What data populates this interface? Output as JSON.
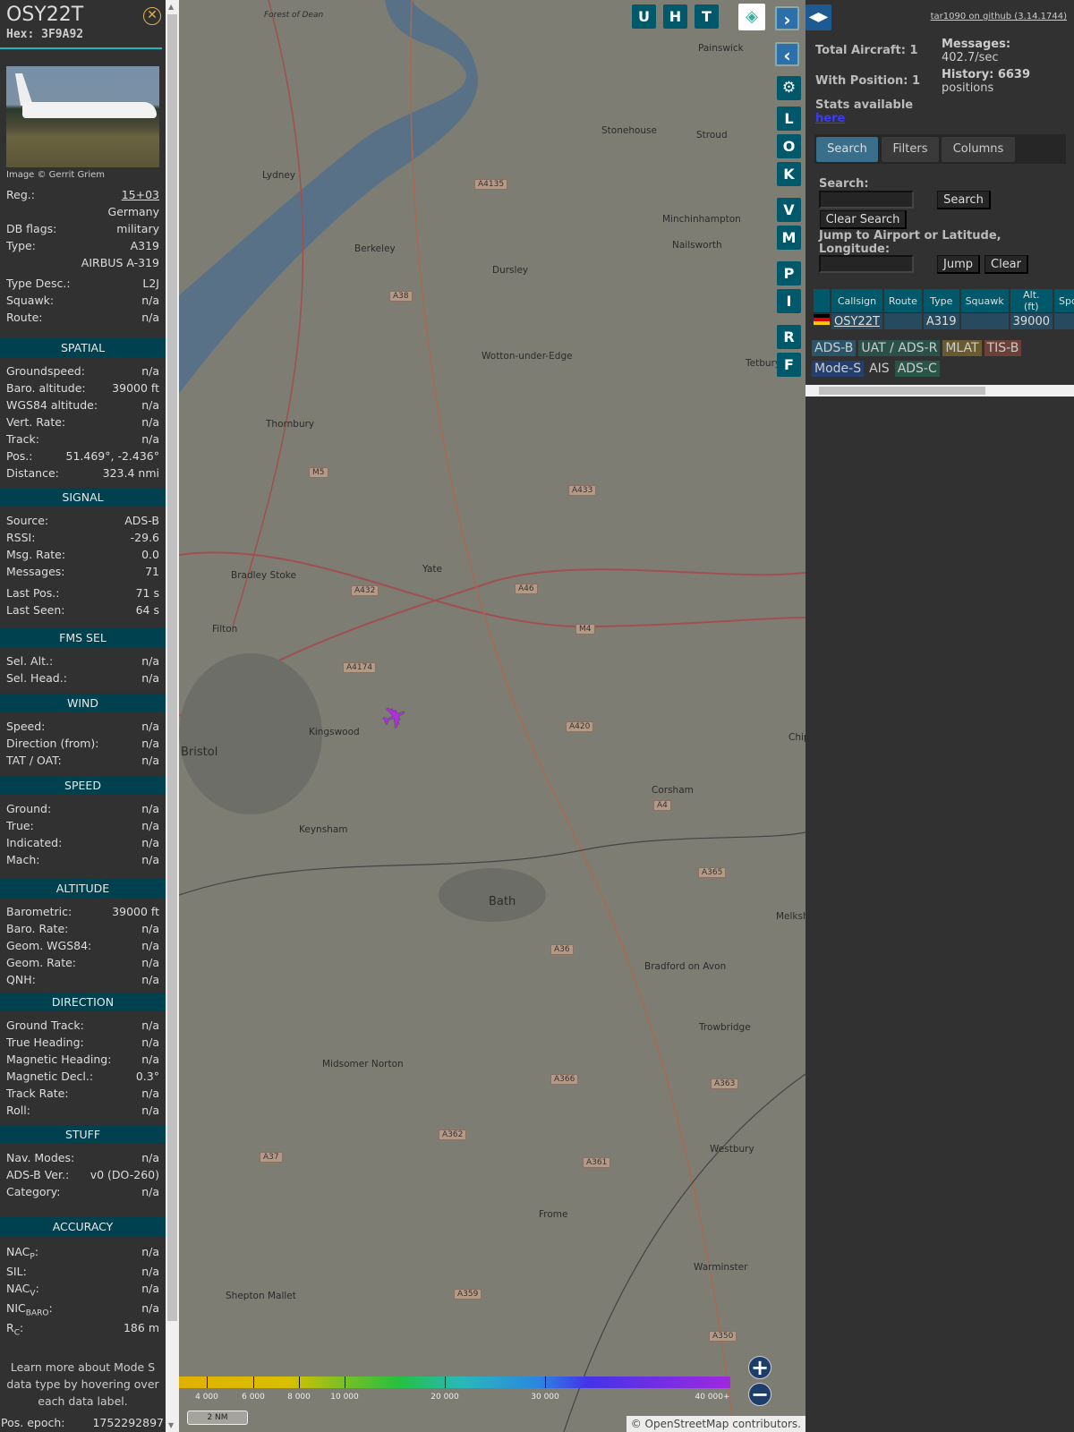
{
  "aircraft": {
    "callsign": "OSY22T",
    "hex_label": "Hex:",
    "hex": "3F9A92",
    "image_credit": "Image © Gerrit Griem",
    "info_rows": [
      {
        "label": "Reg.:",
        "value": "15+03"
      },
      {
        "label": "",
        "value": "Germany"
      },
      {
        "label": "DB flags:",
        "value": "military"
      },
      {
        "label": "Type:",
        "value": "A319"
      },
      {
        "label": "",
        "value": "AIRBUS A-319"
      },
      {
        "label": "Type Desc.:",
        "value": "L2J"
      },
      {
        "label": "Squawk:",
        "value": "n/a"
      },
      {
        "label": "Route:",
        "value": "n/a"
      }
    ],
    "sections": [
      {
        "title": "SPATIAL",
        "rows": [
          {
            "label": "Groundspeed:",
            "value": "n/a"
          },
          {
            "label": "Baro. altitude:",
            "value": "39000 ft"
          },
          {
            "label": "WGS84 altitude:",
            "value": "n/a"
          },
          {
            "label": "Vert. Rate:",
            "value": "n/a"
          },
          {
            "label": "Track:",
            "value": "n/a"
          },
          {
            "label": "Pos.:",
            "value": "51.469°, -2.436°"
          },
          {
            "label": "Distance:",
            "value": "323.4 nmi"
          }
        ]
      },
      {
        "title": "SIGNAL",
        "rows": [
          {
            "label": "Source:",
            "value": "ADS-B"
          },
          {
            "label": "RSSI:",
            "value": "-29.6"
          },
          {
            "label": "Msg. Rate:",
            "value": "0.0"
          },
          {
            "label": "Messages:",
            "value": "71"
          },
          {
            "label": "Last Pos.:",
            "value": "71 s"
          },
          {
            "label": "Last Seen:",
            "value": "64 s"
          }
        ]
      },
      {
        "title": "FMS SEL",
        "rows": [
          {
            "label": "Sel. Alt.:",
            "value": "n/a"
          },
          {
            "label": "Sel. Head.:",
            "value": "n/a"
          }
        ]
      },
      {
        "title": "WIND",
        "rows": [
          {
            "label": "Speed:",
            "value": "n/a"
          },
          {
            "label": "Direction (from):",
            "value": "n/a"
          },
          {
            "label": "TAT / OAT:",
            "value": "n/a"
          }
        ]
      },
      {
        "title": "SPEED",
        "rows": [
          {
            "label": "Ground:",
            "value": "n/a"
          },
          {
            "label": "True:",
            "value": "n/a"
          },
          {
            "label": "Indicated:",
            "value": "n/a"
          },
          {
            "label": "Mach:",
            "value": "n/a"
          }
        ]
      },
      {
        "title": "ALTITUDE",
        "rows": [
          {
            "label": "Barometric:",
            "value": "39000 ft"
          },
          {
            "label": "Baro. Rate:",
            "value": "n/a"
          },
          {
            "label": "Geom. WGS84:",
            "value": "n/a"
          },
          {
            "label": "Geom. Rate:",
            "value": "n/a"
          },
          {
            "label": "QNH:",
            "value": "n/a"
          }
        ]
      },
      {
        "title": "DIRECTION",
        "rows": [
          {
            "label": "Ground Track:",
            "value": "n/a"
          },
          {
            "label": "True Heading:",
            "value": "n/a"
          },
          {
            "label": "Magnetic Heading:",
            "value": "n/a"
          },
          {
            "label": "Magnetic Decl.:",
            "value": "0.3°"
          },
          {
            "label": "Track Rate:",
            "value": "n/a"
          },
          {
            "label": "Roll:",
            "value": "n/a"
          }
        ]
      },
      {
        "title": "STUFF",
        "rows": [
          {
            "label": "Nav. Modes:",
            "value": "n/a"
          },
          {
            "label": "ADS-B Ver.:",
            "value": "v0 (DO-260)"
          },
          {
            "label": "Category:",
            "value": "n/a"
          }
        ]
      }
    ],
    "accuracy": {
      "title": "ACCURACY",
      "nacp": {
        "label": "NAC",
        "sub": "P",
        "value": "n/a"
      },
      "sil": {
        "label": "SIL:",
        "value": "n/a"
      },
      "nacv": {
        "label": "NAC",
        "sub": "V",
        "value": "n/a"
      },
      "nicbaro": {
        "label": "NIC",
        "sub": "BARO",
        "value": "n/a"
      },
      "rc": {
        "label": "R",
        "sub": "C",
        "value": "186 m"
      }
    },
    "help_text": "Learn more about Mode S data type by hovering over each data label.",
    "pos_epoch": {
      "label": "Pos. epoch:",
      "value": "1752292897"
    }
  },
  "map": {
    "top_buttons": [
      "U",
      "H",
      "T"
    ],
    "side_buttons": [
      "L",
      "O",
      "K",
      "V",
      "M",
      "P",
      "I",
      "R",
      "F"
    ],
    "towns": [
      "Forest of Dean",
      "Painswick",
      "Stonehouse",
      "Stroud",
      "Lydney",
      "Minchinhampton",
      "Nailsworth",
      "Berkeley",
      "Dursley",
      "Wotton-under-Edge",
      "Tetbury",
      "Thornbury",
      "Yate",
      "Bradley Stoke",
      "Filton",
      "Kingswood",
      "Bristol",
      "Keynsham",
      "Corsham",
      "Bath",
      "Melksham",
      "Bradford on Avon",
      "Trowbridge",
      "Midsomer Norton",
      "Westbury",
      "Frome",
      "Warminster",
      "Shepton Mallet",
      "Chippenham"
    ],
    "roads": [
      "A4135",
      "A38",
      "M5",
      "A433",
      "A432",
      "A46",
      "M4",
      "A4174",
      "A420",
      "A4",
      "A365",
      "A36",
      "A366",
      "A363",
      "A362",
      "A37",
      "A361",
      "A359",
      "A350"
    ],
    "altitude_legend": [
      "4 000",
      "6 000",
      "8 000",
      "10 000",
      "20 000",
      "30 000",
      "40 000+"
    ],
    "scale": "2 NM",
    "attribution_prefix": "©",
    "attribution_link": "OpenStreetMap",
    "attribution_suffix": "contributors."
  },
  "stats": {
    "github": "tar1090 on github (3.14.1744)",
    "total_aircraft": "Total Aircraft: 1",
    "with_position": "With Position: 1",
    "stats_available": "Stats available",
    "here": "here",
    "messages_label": "Messages:",
    "messages_value": "402.7/sec",
    "history_label": "History: 6639",
    "history_value": "positions"
  },
  "tabs": [
    "Search",
    "Filters",
    "Columns"
  ],
  "search": {
    "label": "Search:",
    "value": "",
    "search_button": "Search",
    "clear_button": "Clear Search",
    "jump_label": "Jump to Airport or Latitude, Longitude:",
    "jump_value": "",
    "jump_button": "Jump",
    "jump_clear": "Clear"
  },
  "table": {
    "columns": [
      "",
      "Callsign",
      "Route",
      "Type",
      "Squawk",
      "Alt. (ft)",
      "Spd."
    ],
    "rows": [
      {
        "callsign": "OSY22T",
        "route": "",
        "type": "A319",
        "squawk": "",
        "alt": "39000",
        "spd": ""
      }
    ]
  },
  "source_badges": [
    {
      "label": "ADS-B",
      "color": "#2a5568"
    },
    {
      "label": "UAT / ADS-R",
      "color": "#2a5048"
    },
    {
      "label": "MLAT",
      "color": "#6a5a30"
    },
    {
      "label": "TIS-B",
      "color": "#6a4038"
    },
    {
      "label": "Mode-S",
      "color": "#243e6e"
    },
    {
      "label": "AIS",
      "color": "transparent"
    },
    {
      "label": "ADS-C",
      "color": "#285548"
    }
  ]
}
